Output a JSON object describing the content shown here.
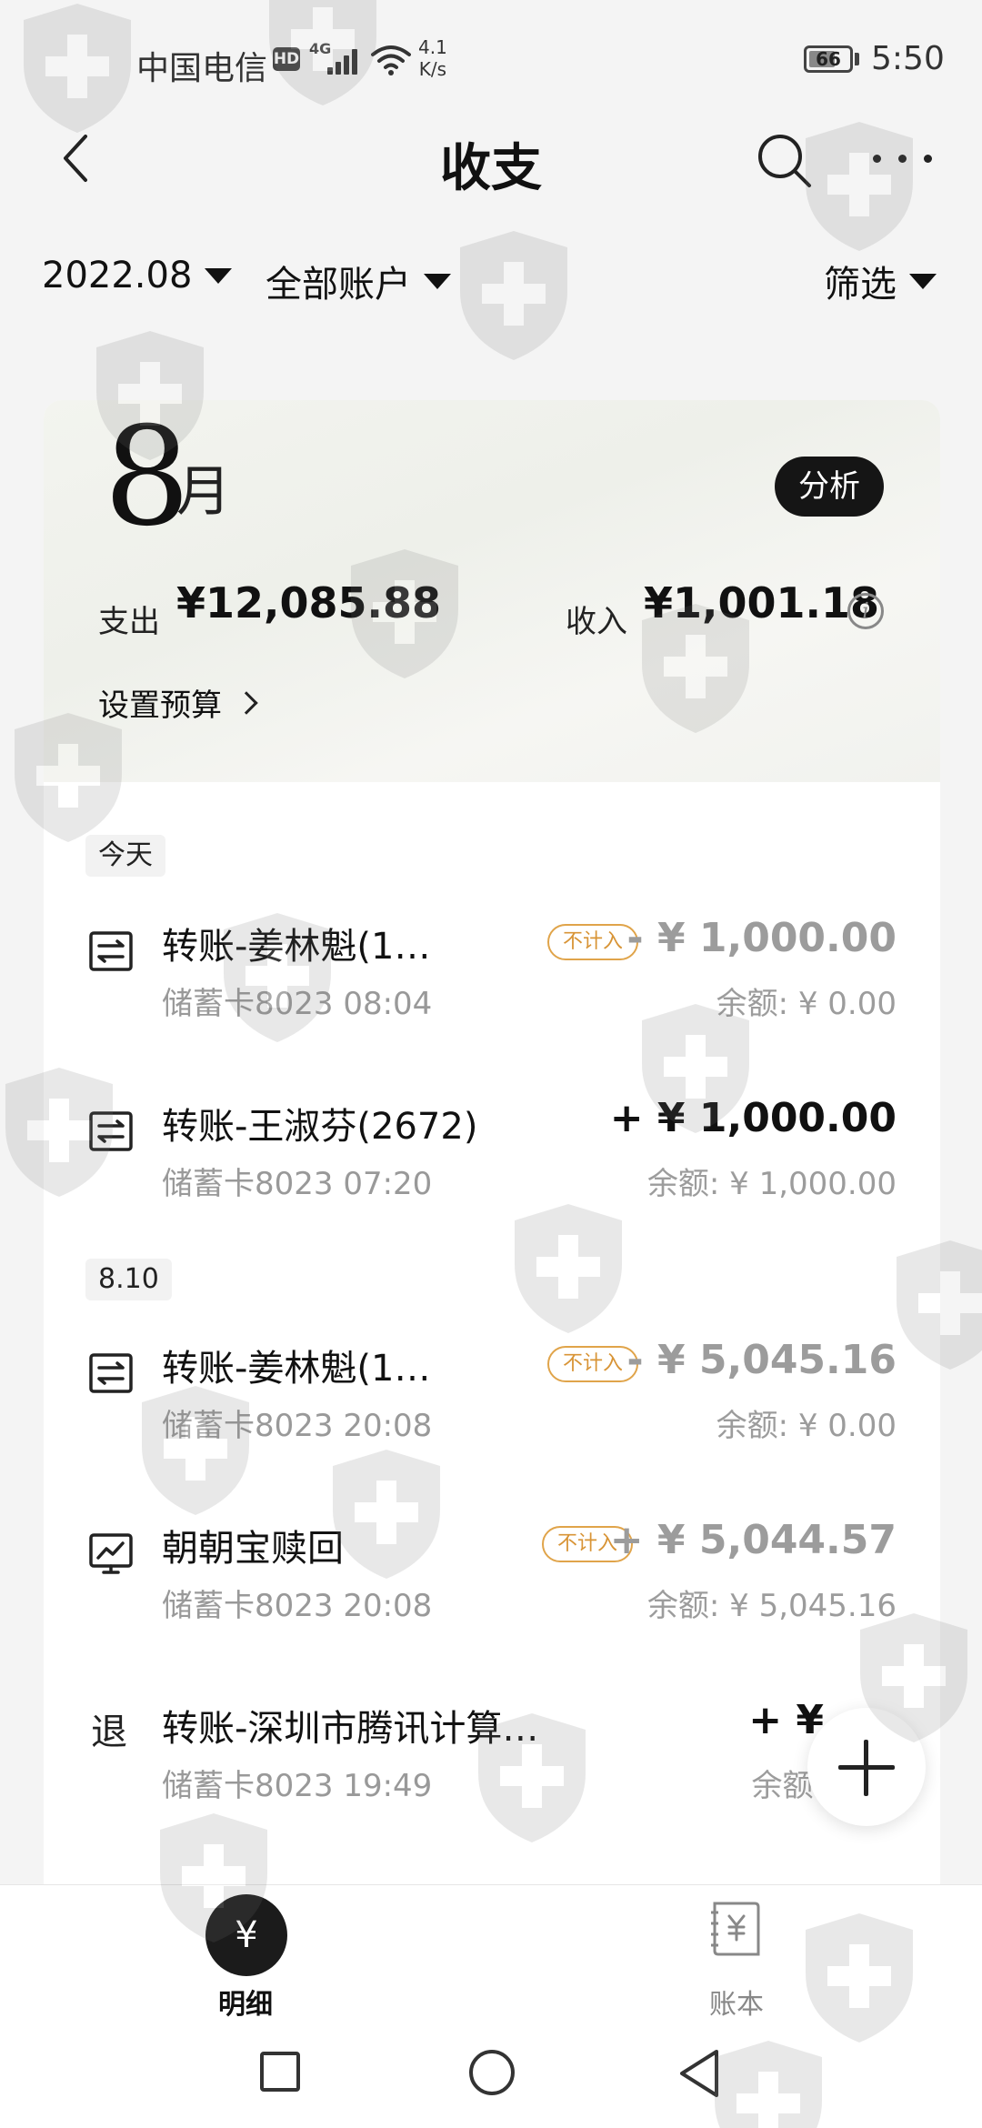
{
  "status_bar": {
    "carrier": "中国电信",
    "hd": "HD",
    "network": "4G",
    "speed_value": "4.1",
    "speed_unit": "K/s",
    "battery": "66",
    "battery_level": 0.66,
    "time": "5:50"
  },
  "header": {
    "title": "收支",
    "back_icon": "chevron-left-icon",
    "search_icon": "search-icon",
    "more_icon": "more-dots-icon"
  },
  "filters": {
    "period": "2022.08",
    "account": "全部账户",
    "filter": "筛选"
  },
  "month_card": {
    "month_number": "8",
    "month_unit": "月",
    "analysis_button": "分析",
    "expense_label": "支出",
    "expense_value": "¥12,085.88",
    "income_label": "收入",
    "income_value": "¥1,001.18",
    "info_icon": "i",
    "budget_link": "设置预算"
  },
  "groups": [
    {
      "date": "今天",
      "transactions": [
        {
          "icon": "transfer-icon",
          "title": "转账-姜林魁(1…",
          "tag": "不计入",
          "amount": "- ¥ 1,000.00",
          "subtitle": "储蓄卡8023 08:04",
          "balance": "余额: ¥ 0.00"
        },
        {
          "icon": "transfer-icon",
          "title": "转账-王淑芬(2672)",
          "tag": "",
          "amount": "+ ¥ 1,000.00",
          "subtitle": "储蓄卡8023 07:20",
          "balance": "余额: ¥ 1,000.00"
        }
      ]
    },
    {
      "date": "8.10",
      "transactions": [
        {
          "icon": "transfer-icon",
          "title": "转账-姜林魁(1…",
          "tag": "不计入",
          "amount": "- ¥ 5,045.16",
          "subtitle": "储蓄卡8023 20:08",
          "balance": "余额: ¥ 0.00"
        },
        {
          "icon": "trend-chart-icon",
          "title": "朝朝宝赎回",
          "tag": "不计入",
          "amount": "+ ¥ 5,044.57",
          "subtitle": "储蓄卡8023 20:08",
          "balance": "余额: ¥ 5,045.16"
        },
        {
          "icon_text": "退",
          "title": "转账-深圳市腾讯计算…",
          "tag": "",
          "amount": "+ ¥ ",
          "subtitle": "储蓄卡8023 19:49",
          "balance": "余额:"
        }
      ]
    }
  ],
  "fab": {
    "icon": "plus-icon"
  },
  "bottom_nav": {
    "items": [
      {
        "label": "明细",
        "icon_text": "¥",
        "active": true
      },
      {
        "label": "账本",
        "icon_text": "¥",
        "active": false
      }
    ]
  },
  "system_nav": {
    "recent_icon": "square-icon",
    "home_icon": "circle-icon",
    "back_icon": "triangle-back-icon"
  }
}
